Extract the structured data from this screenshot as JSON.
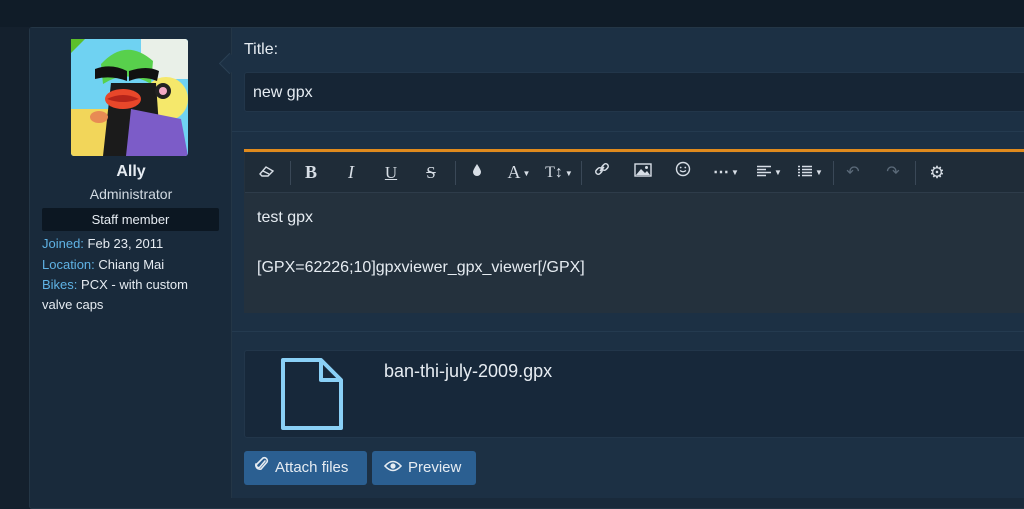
{
  "user": {
    "name": "Ally",
    "title": "Administrator",
    "badge": "Staff member",
    "info": [
      {
        "key": "Joined:",
        "value": "Feb 23, 2011"
      },
      {
        "key": "Location:",
        "value": "Chiang Mai"
      },
      {
        "key": "Bikes:",
        "value": "PCX - with custom",
        "cont": "valve caps"
      }
    ]
  },
  "form": {
    "title_label": "Title:",
    "title_value": "new gpx"
  },
  "editor": {
    "line1": "test gpx",
    "line2": "[GPX=62226;10]gpxviewer_gpx_viewer[/GPX]"
  },
  "toolbar": {
    "icons": [
      "eraser-icon",
      "bold-icon",
      "italic-icon",
      "underline-icon",
      "strikethrough-icon",
      "color-icon",
      "font-family-icon",
      "font-size-icon",
      "link-icon",
      "image-icon",
      "smilie-icon",
      "more-icon",
      "align-icon",
      "list-icon",
      "undo-icon",
      "redo-icon",
      "settings-icon"
    ]
  },
  "attachment": {
    "file_name": "ban-thi-july-2009.gpx",
    "icon": "file-icon"
  },
  "buttons": {
    "attach_label": "Attach files",
    "preview_label": "Preview"
  },
  "colors": {
    "accent": "#e08a1d",
    "button": "#2b5f91",
    "link": "#5fb2e4",
    "online": "#5cbf2a"
  }
}
